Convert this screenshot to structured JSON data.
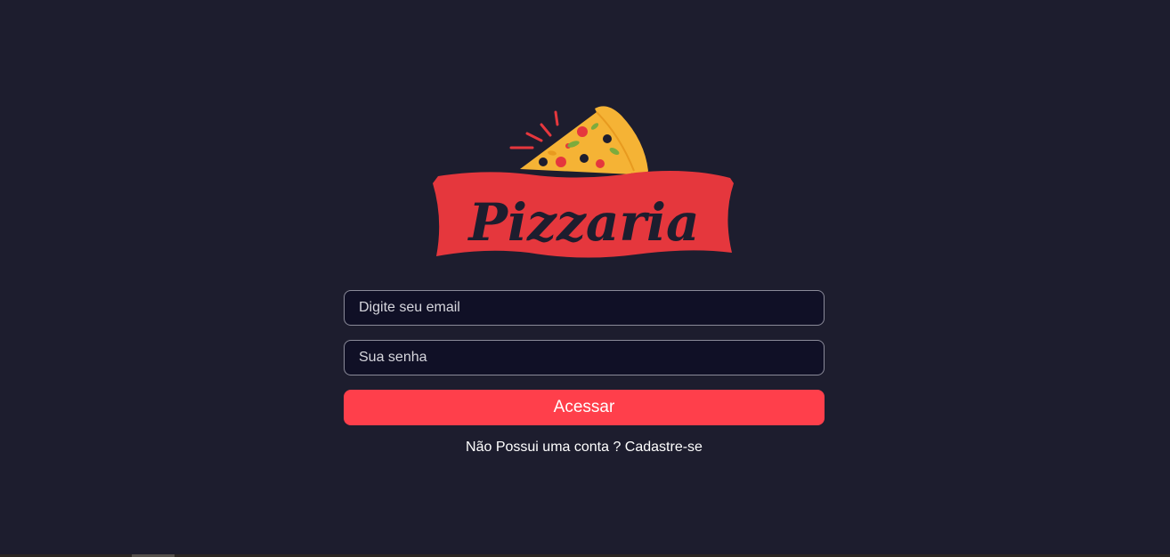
{
  "logo": {
    "text": "Pizzaria",
    "banner_color": "#e5373d",
    "text_color": "#1d1d2e",
    "crust_color": "#f5b335"
  },
  "form": {
    "email_placeholder": "Digite seu email",
    "password_placeholder": "Sua senha",
    "submit_label": "Acessar",
    "signup_text": "Não Possui uma conta ? Cadastre-se"
  },
  "colors": {
    "background": "#1d1d2e",
    "input_background": "#101026",
    "input_border": "#8a8a99",
    "accent": "#ff3f4b"
  }
}
